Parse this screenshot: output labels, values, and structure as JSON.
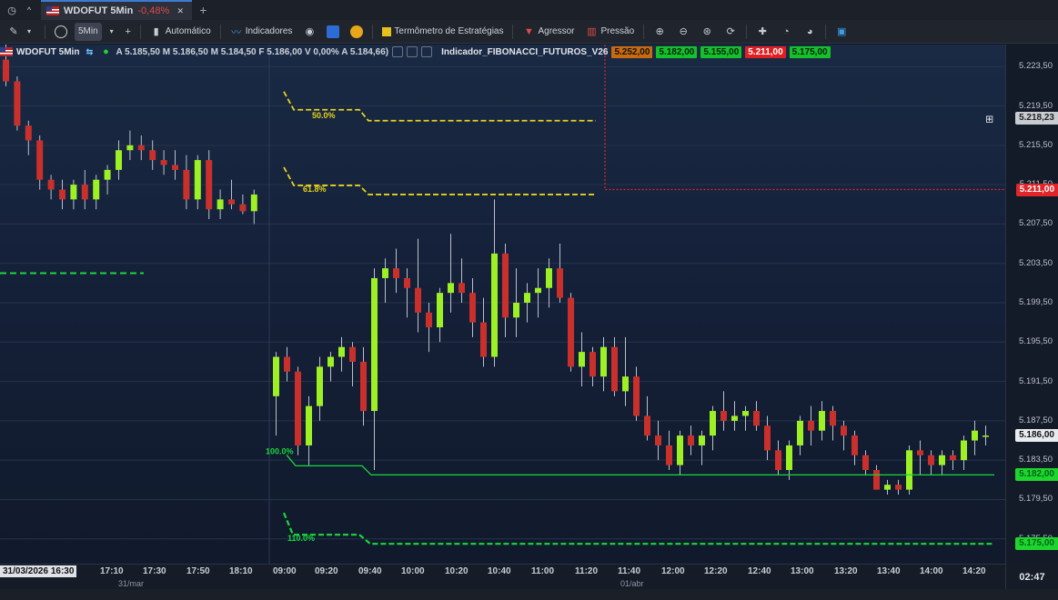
{
  "tabs": [
    {
      "label": "WDOFUT 5Min",
      "change": "-0,48%"
    }
  ],
  "toolbar": {
    "timeframe": "5Min",
    "auto_label": "Automático",
    "indicators_label": "Indicadores",
    "strategy_label": "Termômetro de Estratégias",
    "aggressor_label": "Agressor",
    "pressure_label": "Pressão"
  },
  "infobar": {
    "symbol": "WDOFUT 5Min",
    "ohlc": "A 5.185,50 M 5.186,50 M 5.184,50 F 5.186,00 V 0,00% A 5.184,66)",
    "indicator": "Indicador_FIBONACCI_FUTUROS_V26",
    "values": [
      "5.252,00",
      "5.182,00",
      "5.155,00",
      "5.211,00",
      "5.175,00"
    ]
  },
  "price_axis": {
    "labels": [
      "5.223,50",
      "5.219,50",
      "5.215,50",
      "5.211,50",
      "5.207,50",
      "5.203,50",
      "5.199,50",
      "5.195,50",
      "5.191,50",
      "5.187,50",
      "5.183,50",
      "5.179,50",
      "5.175,50"
    ],
    "label_values": [
      5223.5,
      5219.5,
      5215.5,
      5211.5,
      5207.5,
      5203.5,
      5199.5,
      5195.5,
      5191.5,
      5187.5,
      5183.5,
      5179.5,
      5175.5
    ],
    "tag_hover": "5.218,23",
    "tag_red": "5.211,00",
    "tag_current": "5.186,00",
    "tag_green1": "5.182,00",
    "tag_green2": "5.175,00"
  },
  "time_axis": {
    "start": "31/03/2026 16:30",
    "labels": [
      "17:10",
      "17:30",
      "17:50",
      "18:10",
      "09:00",
      "09:20",
      "09:40",
      "10:00",
      "10:20",
      "10:40",
      "11:00",
      "11:20",
      "11:40",
      "12:00",
      "12:20",
      "12:40",
      "13:00",
      "13:20",
      "13:40",
      "14:00",
      "14:20"
    ],
    "dates": [
      "31/mar",
      "01/abr"
    ],
    "clock": "02:47"
  },
  "fib_labels": {
    "f50": "50.0%",
    "f61": "61.8%",
    "f100": "100.0%",
    "f110": "110.0%"
  },
  "colors": {
    "bull": "#9cf024",
    "bear": "#c9302c",
    "fib": "#e6d21c",
    "green_line": "#18d83a",
    "red_line": "#e0262a"
  },
  "chart_data": {
    "type": "candlestick",
    "candles": [
      [
        5224.2,
        5226.0,
        5221.5,
        5222.0
      ],
      [
        5222.0,
        5222.5,
        5217.0,
        5217.5
      ],
      [
        5217.5,
        5218.0,
        5214.5,
        5216.0
      ],
      [
        5216.0,
        5216.5,
        5211.0,
        5212.0
      ],
      [
        5212.0,
        5212.5,
        5210.0,
        5211.0
      ],
      [
        5211.0,
        5212.0,
        5209.0,
        5210.0
      ],
      [
        5210.0,
        5212.0,
        5209.0,
        5211.5
      ],
      [
        5211.5,
        5213.0,
        5209.0,
        5210.0
      ],
      [
        5210.0,
        5212.5,
        5209.0,
        5212.0
      ],
      [
        5212.0,
        5213.5,
        5210.5,
        5213.0
      ],
      [
        5213.0,
        5216.0,
        5212.0,
        5215.0
      ],
      [
        5215.0,
        5217.0,
        5214.0,
        5215.5
      ],
      [
        5215.5,
        5216.5,
        5214.0,
        5215.0
      ],
      [
        5215.0,
        5216.0,
        5213.0,
        5214.0
      ],
      [
        5214.0,
        5215.0,
        5212.5,
        5213.5
      ],
      [
        5213.5,
        5215.0,
        5212.0,
        5213.0
      ],
      [
        5213.0,
        5214.5,
        5209.0,
        5210.0
      ],
      [
        5210.0,
        5214.5,
        5209.0,
        5214.0
      ],
      [
        5214.0,
        5215.0,
        5208.0,
        5209.0
      ],
      [
        5209.0,
        5211.0,
        5208.0,
        5210.0
      ],
      [
        5210.0,
        5212.0,
        5209.0,
        5209.5
      ],
      [
        5209.5,
        5210.5,
        5208.5,
        5208.8
      ],
      [
        5208.8,
        5211.0,
        5207.5,
        5210.5
      ],
      [
        5190.0,
        5194.5,
        5186.0,
        5194.0
      ],
      [
        5194.0,
        5195.0,
        5191.5,
        5192.5
      ],
      [
        5192.5,
        5193.0,
        5184.0,
        5185.0
      ],
      [
        5185.0,
        5190.0,
        5183.0,
        5189.0
      ],
      [
        5189.0,
        5194.0,
        5187.5,
        5193.0
      ],
      [
        5193.0,
        5194.5,
        5191.5,
        5194.0
      ],
      [
        5194.0,
        5196.0,
        5192.5,
        5195.0
      ],
      [
        5195.0,
        5195.5,
        5191.0,
        5193.5
      ],
      [
        5193.5,
        5195.0,
        5187.0,
        5188.5
      ],
      [
        5188.5,
        5203.0,
        5182.5,
        5202.0
      ],
      [
        5202.0,
        5204.0,
        5199.5,
        5203.0
      ],
      [
        5203.0,
        5205.0,
        5200.5,
        5202.0
      ],
      [
        5202.0,
        5203.0,
        5198.0,
        5201.0
      ],
      [
        5201.0,
        5206.0,
        5196.5,
        5198.5
      ],
      [
        5198.5,
        5199.5,
        5194.5,
        5197.0
      ],
      [
        5197.0,
        5201.0,
        5195.5,
        5200.5
      ],
      [
        5200.5,
        5206.5,
        5198.5,
        5201.5
      ],
      [
        5201.5,
        5204.0,
        5199.5,
        5200.5
      ],
      [
        5200.5,
        5202.0,
        5196.0,
        5197.5
      ],
      [
        5197.5,
        5200.0,
        5193.0,
        5194.0
      ],
      [
        5194.0,
        5210.0,
        5193.0,
        5204.5
      ],
      [
        5204.5,
        5205.5,
        5196.0,
        5198.0
      ],
      [
        5198.0,
        5203.0,
        5196.0,
        5199.5
      ],
      [
        5199.5,
        5201.5,
        5197.5,
        5200.5
      ],
      [
        5200.5,
        5203.0,
        5198.0,
        5201.0
      ],
      [
        5201.0,
        5204.0,
        5199.0,
        5203.0
      ],
      [
        5203.0,
        5205.5,
        5199.5,
        5200.0
      ],
      [
        5200.0,
        5200.5,
        5192.5,
        5193.0
      ],
      [
        5193.0,
        5196.5,
        5191.0,
        5194.5
      ],
      [
        5194.5,
        5195.0,
        5191.0,
        5192.0
      ],
      [
        5192.0,
        5196.0,
        5190.5,
        5195.0
      ],
      [
        5195.0,
        5196.0,
        5190.0,
        5190.5
      ],
      [
        5190.5,
        5196.0,
        5189.0,
        5192.0
      ],
      [
        5192.0,
        5193.0,
        5187.5,
        5188.0
      ],
      [
        5188.0,
        5190.0,
        5185.5,
        5186.0
      ],
      [
        5186.0,
        5187.5,
        5183.5,
        5185.0
      ],
      [
        5185.0,
        5186.5,
        5182.5,
        5183.0
      ],
      [
        5183.0,
        5186.5,
        5182.0,
        5186.0
      ],
      [
        5186.0,
        5187.0,
        5184.0,
        5185.0
      ],
      [
        5185.0,
        5186.5,
        5183.0,
        5186.0
      ],
      [
        5186.0,
        5189.0,
        5184.5,
        5188.5
      ],
      [
        5188.5,
        5190.5,
        5186.5,
        5187.5
      ],
      [
        5187.5,
        5189.5,
        5186.5,
        5188.0
      ],
      [
        5188.0,
        5189.0,
        5186.5,
        5188.5
      ],
      [
        5188.5,
        5189.5,
        5186.5,
        5187.0
      ],
      [
        5187.0,
        5188.0,
        5183.5,
        5184.5
      ],
      [
        5184.5,
        5185.5,
        5182.0,
        5182.5
      ],
      [
        5182.5,
        5185.5,
        5181.5,
        5185.0
      ],
      [
        5185.0,
        5188.0,
        5184.0,
        5187.5
      ],
      [
        5187.5,
        5189.0,
        5185.0,
        5186.5
      ],
      [
        5186.5,
        5189.5,
        5185.5,
        5188.5
      ],
      [
        5188.5,
        5189.0,
        5185.5,
        5187.0
      ],
      [
        5187.0,
        5187.5,
        5184.5,
        5186.0
      ],
      [
        5186.0,
        5186.5,
        5183.0,
        5184.0
      ],
      [
        5184.0,
        5184.5,
        5182.0,
        5182.5
      ],
      [
        5182.5,
        5183.0,
        5180.5,
        5180.5
      ],
      [
        5180.5,
        5181.5,
        5180.0,
        5181.0
      ],
      [
        5181.0,
        5181.5,
        5180.0,
        5180.5
      ],
      [
        5180.5,
        5185.0,
        5180.0,
        5184.5
      ],
      [
        5184.5,
        5185.5,
        5182.0,
        5184.0
      ],
      [
        5184.0,
        5184.5,
        5182.0,
        5183.0
      ],
      [
        5183.0,
        5184.5,
        5182.0,
        5184.0
      ],
      [
        5184.0,
        5184.5,
        5182.5,
        5183.5
      ],
      [
        5183.5,
        5186.0,
        5182.5,
        5185.5
      ],
      [
        5185.5,
        5187.5,
        5184.0,
        5186.5
      ],
      [
        5186.0,
        5187.0,
        5185.0,
        5186.0
      ]
    ],
    "gap_after_index": 22,
    "levels": {
      "green_dashed_left": 5202.5,
      "red_dotted": 5211.0,
      "fib_50": 5218.0,
      "fib_61": 5210.5,
      "green_100": 5182.0,
      "green_110": 5175.0
    },
    "y_range": [
      5174.0,
      5225.0
    ]
  }
}
